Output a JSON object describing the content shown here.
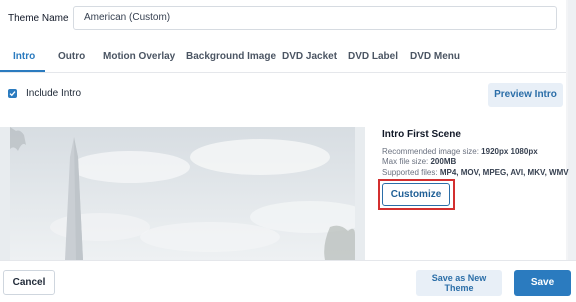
{
  "theme": {
    "label": "Theme Name",
    "value": "American (Custom)"
  },
  "tabs": [
    {
      "label": "Intro",
      "active": true
    },
    {
      "label": "Outro"
    },
    {
      "label": "Motion Overlay"
    },
    {
      "label": "Background Image"
    },
    {
      "label": "DVD Jacket"
    },
    {
      "label": "DVD Label"
    },
    {
      "label": "DVD Menu"
    }
  ],
  "intro": {
    "include_label": "Include Intro",
    "include_checked": true,
    "preview_label": "Preview Intro"
  },
  "scene": {
    "title": "Intro First Scene",
    "recommended_label": "Recommended image size:",
    "recommended_value": "1920px 1080px",
    "max_size_label": "Max file size:",
    "max_size_value": "200MB",
    "supported_label": "Supported files:",
    "supported_value": "MP4, MOV, MPEG, AVI, MKV, WMV",
    "customize_label": "Customize"
  },
  "footer": {
    "cancel_label": "Cancel",
    "save_new_label": "Save as New\nTheme",
    "save_label": "Save"
  },
  "colors": {
    "accent": "#2b7bbf",
    "highlight": "#d32f2f"
  }
}
